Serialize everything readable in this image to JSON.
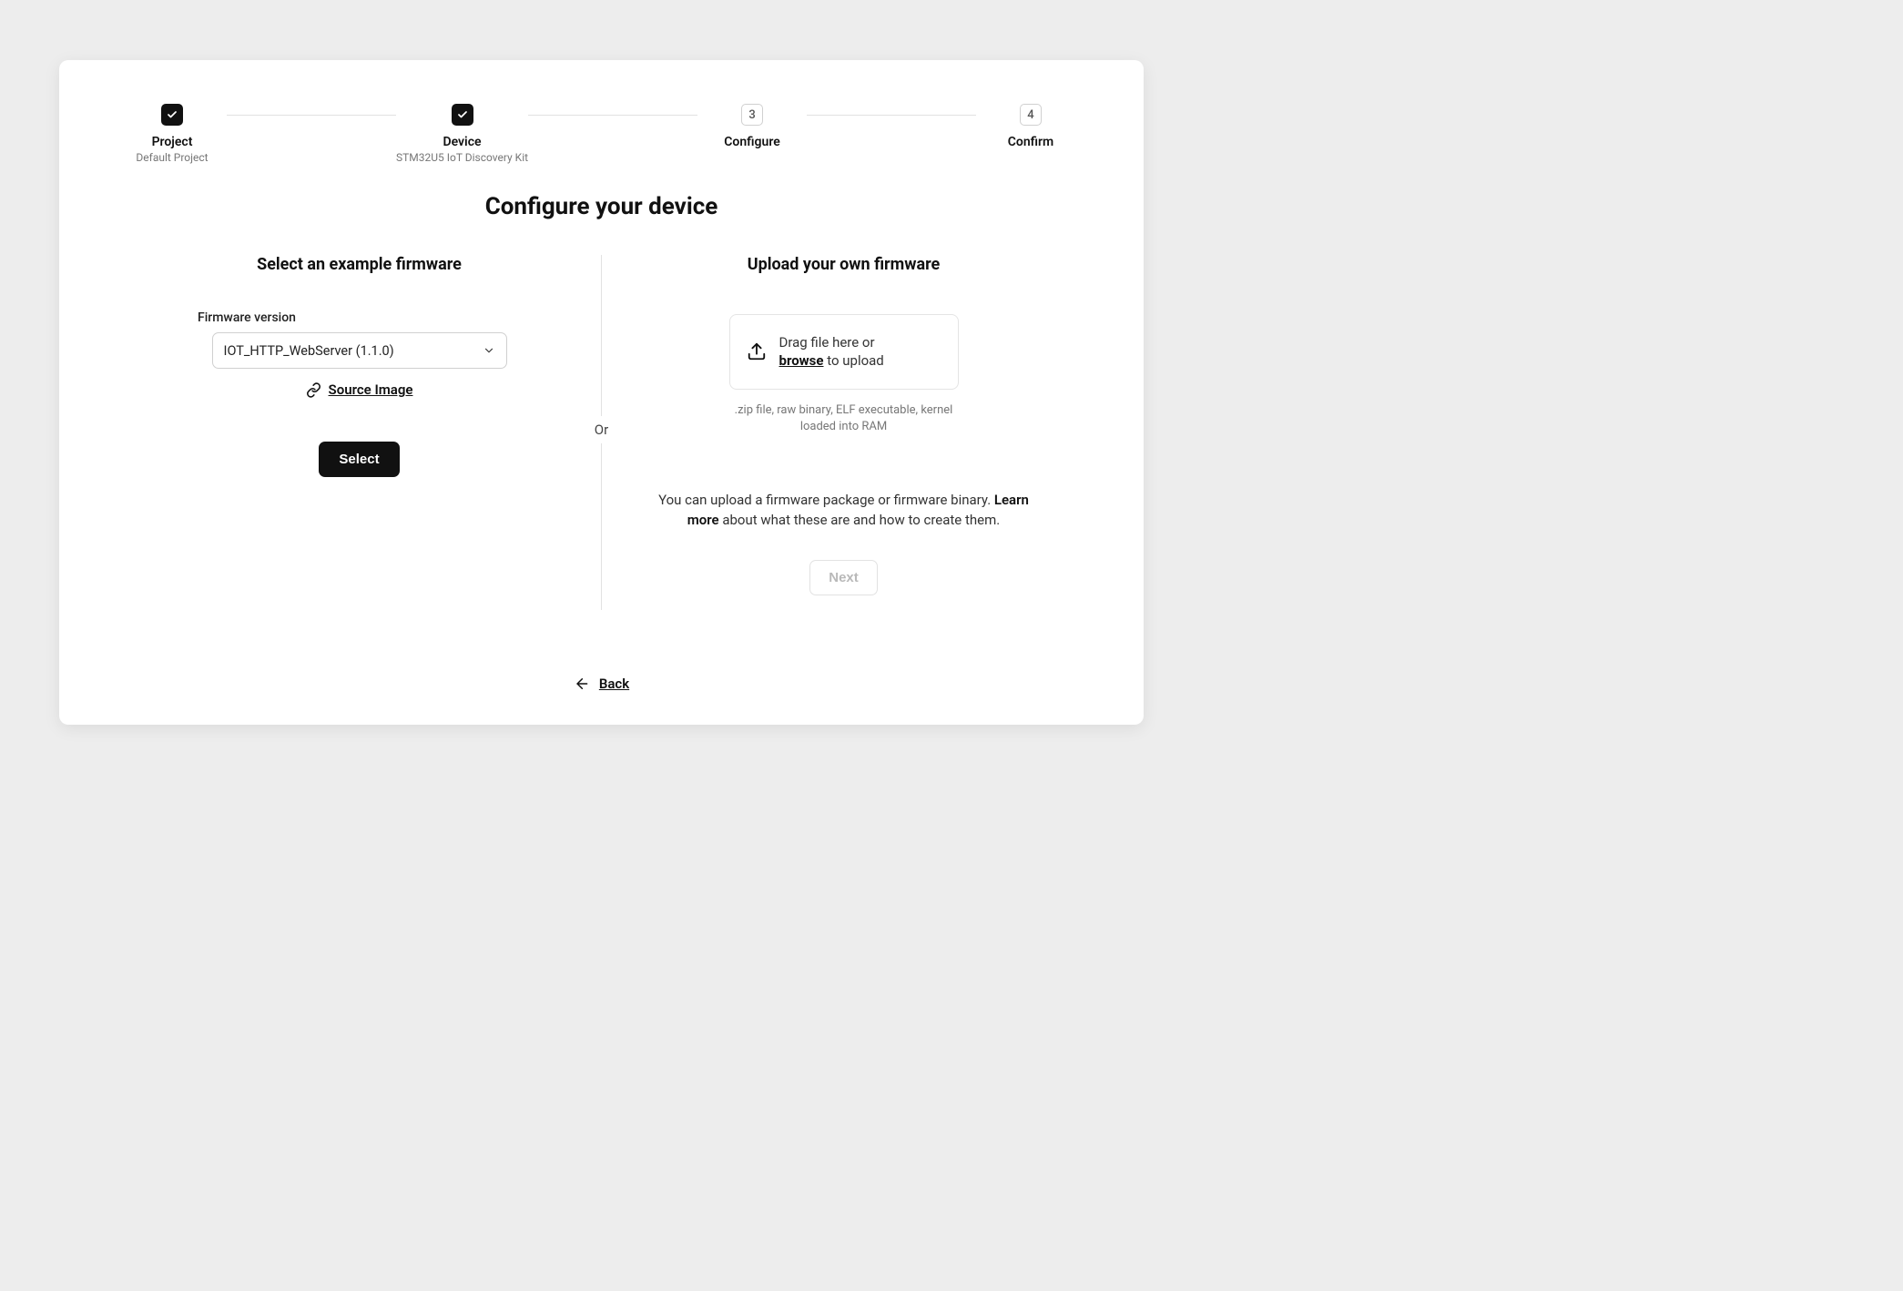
{
  "stepper": {
    "steps": [
      {
        "label": "Project",
        "sub": "Default Project",
        "done": true
      },
      {
        "label": "Device",
        "sub": "STM32U5 IoT Discovery Kit",
        "done": true
      },
      {
        "label": "Configure",
        "sub": "",
        "num": "3"
      },
      {
        "label": "Confirm",
        "sub": "",
        "num": "4"
      }
    ]
  },
  "title": "Configure your device",
  "left": {
    "heading": "Select an example firmware",
    "field_label": "Firmware version",
    "select_value": "IOT_HTTP_WebServer (1.1.0)",
    "source_link": "Source Image",
    "select_btn": "Select"
  },
  "divider_text": "Or",
  "right": {
    "heading": "Upload your own firmware",
    "drop_prefix": "Drag file here or ",
    "drop_browse": "browse",
    "drop_suffix": " to upload",
    "hint": ".zip file, raw binary, ELF executable, kernel loaded into RAM",
    "desc_prefix": "You can upload a firmware package or firmware binary. ",
    "desc_learn": "Learn more",
    "desc_suffix": " about what these are and how to create them.",
    "next_btn": "Next"
  },
  "back": "Back"
}
